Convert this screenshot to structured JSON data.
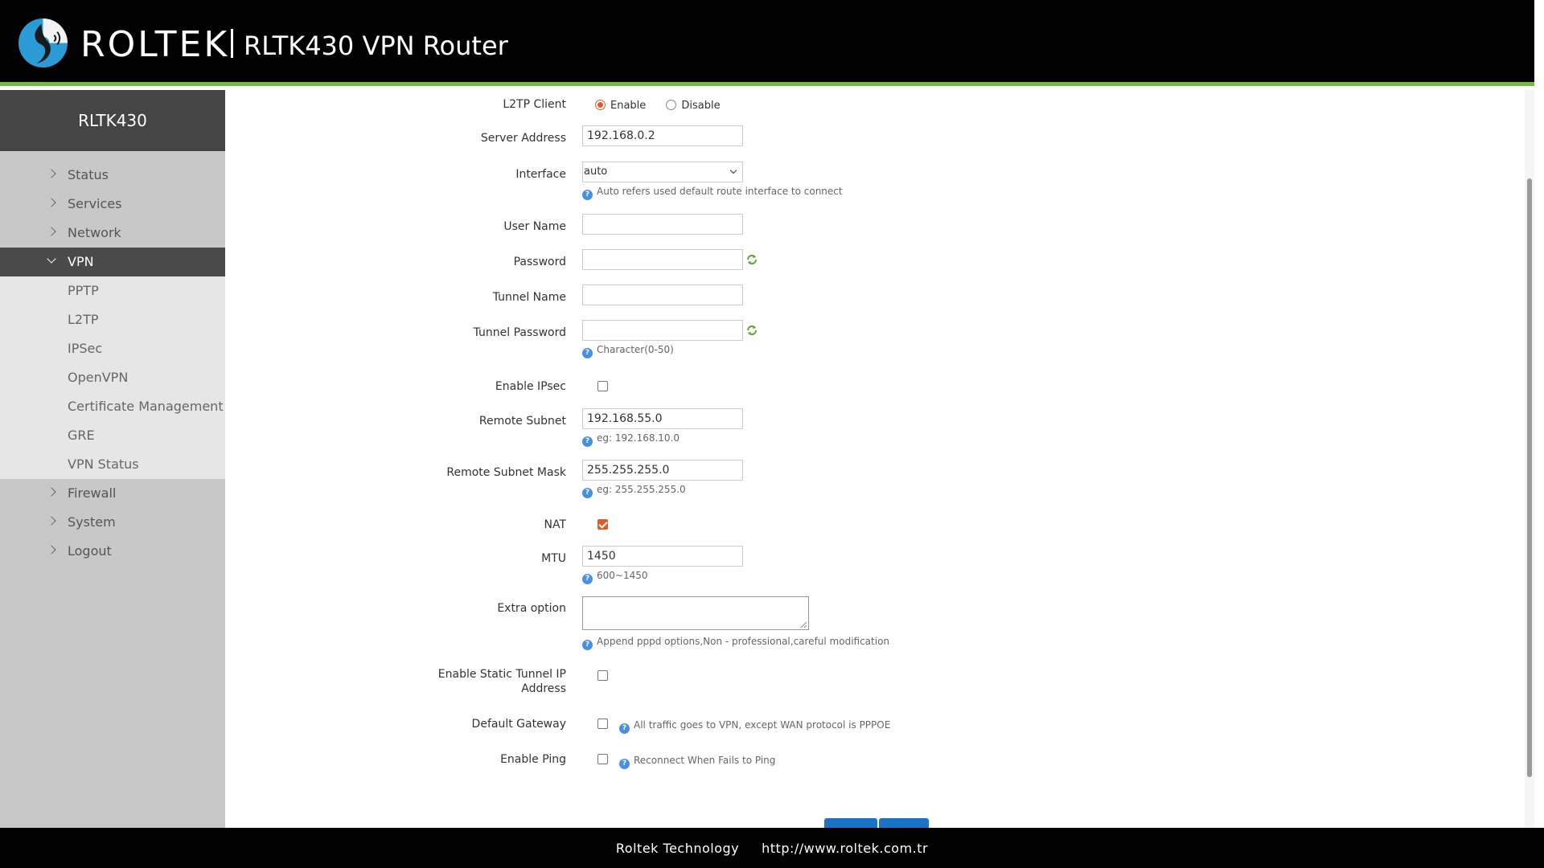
{
  "header": {
    "brand": "ROLTEK",
    "product": "RLTK430 VPN Router"
  },
  "sidebar": {
    "title": "RLTK430",
    "items": [
      {
        "label": "Status"
      },
      {
        "label": "Services"
      },
      {
        "label": "Network"
      },
      {
        "label": "VPN"
      },
      {
        "label": "Firewall"
      },
      {
        "label": "System"
      },
      {
        "label": "Logout"
      }
    ],
    "vpn_sub": [
      {
        "label": "PPTP"
      },
      {
        "label": "L2TP"
      },
      {
        "label": "IPSec"
      },
      {
        "label": "OpenVPN"
      },
      {
        "label": "Certificate Management"
      },
      {
        "label": "GRE"
      },
      {
        "label": "VPN Status"
      }
    ],
    "active": "VPN"
  },
  "form": {
    "l2tp_client": {
      "label": "L2TP Client",
      "enable": "Enable",
      "disable": "Disable",
      "selected": "Enable"
    },
    "server_address": {
      "label": "Server Address",
      "value": "192.168.0.2"
    },
    "interface": {
      "label": "Interface",
      "value": "auto",
      "hint": "Auto refers used default route interface to connect"
    },
    "user_name": {
      "label": "User Name",
      "value": ""
    },
    "password": {
      "label": "Password",
      "value": ""
    },
    "tunnel_name": {
      "label": "Tunnel Name",
      "value": ""
    },
    "tunnel_password": {
      "label": "Tunnel Password",
      "value": "",
      "hint": "Character(0-50)"
    },
    "enable_ipsec": {
      "label": "Enable IPsec",
      "checked": false
    },
    "remote_subnet": {
      "label": "Remote Subnet",
      "value": "192.168.55.0",
      "hint": "eg: 192.168.10.0"
    },
    "remote_subnet_mask": {
      "label": "Remote Subnet Mask",
      "value": "255.255.255.0",
      "hint": "eg: 255.255.255.0"
    },
    "nat": {
      "label": "NAT",
      "checked": true
    },
    "mtu": {
      "label": "MTU",
      "value": "1450",
      "hint": "600~1450"
    },
    "extra_option": {
      "label": "Extra option",
      "value": "",
      "hint": "Append pppd options,Non - professional,careful modification"
    },
    "static_tunnel_ip": {
      "label": "Enable Static Tunnel IP Address",
      "checked": false
    },
    "default_gateway": {
      "label": "Default Gateway",
      "checked": false,
      "hint": "All traffic goes to VPN, except WAN protocol is PPPOE"
    },
    "enable_ping": {
      "label": "Enable Ping",
      "checked": false,
      "hint": "Reconnect When Fails to Ping"
    }
  },
  "footer": {
    "company": "Roltek Technology",
    "url": "http://www.roltek.com.tr"
  },
  "colors": {
    "accent_green": "#6fbd44",
    "accent_orange": "#e05a2b",
    "button_blue": "#1a73c4"
  }
}
